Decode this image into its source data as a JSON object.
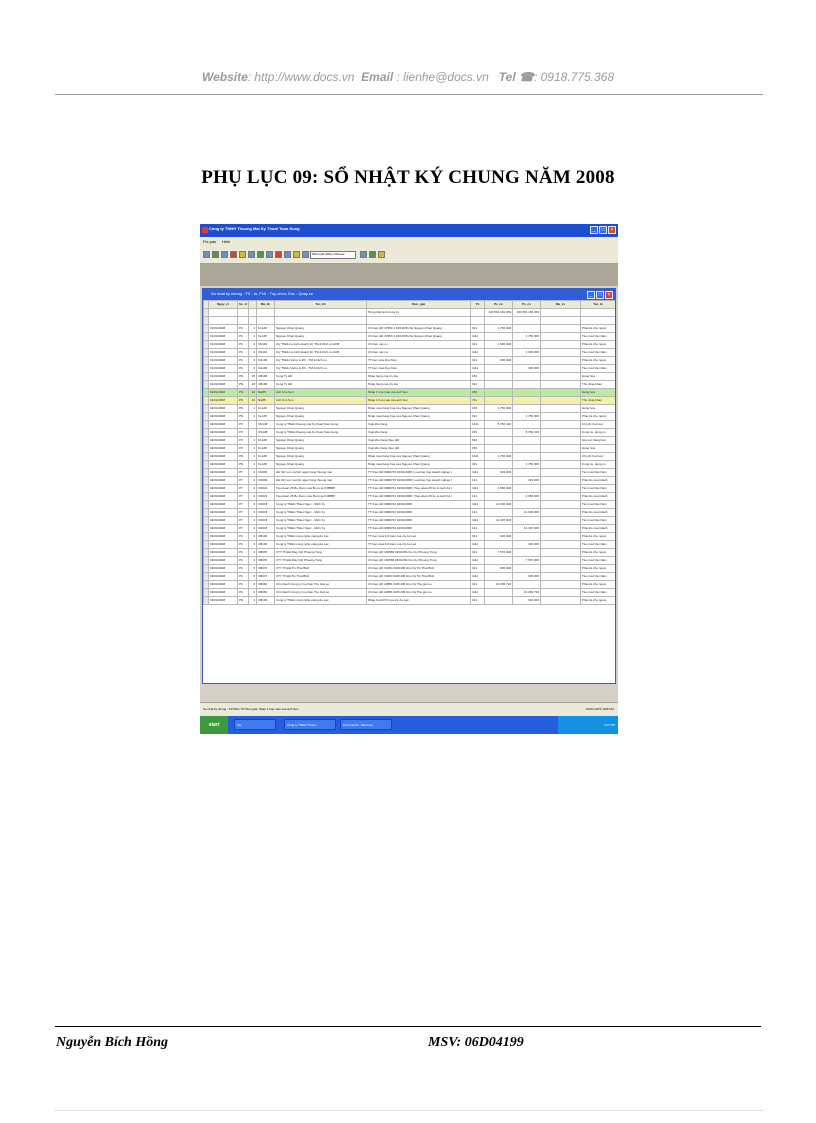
{
  "page_header": {
    "website_label": "Website",
    "website_value": ": http://www.docs.vn",
    "email_label": "Email",
    "email_value": ": lienhe@docs.vn",
    "tel_label": "Tel ☎",
    "tel_value": ": 0918.775.368"
  },
  "title": "PHỤ LỤC 09: SỔ NHẬT KÝ CHUNG NĂM 2008",
  "footer": {
    "author": "Nguyễn Bích Hồng",
    "msv": "MSV: 06D04199"
  },
  "screenshot": {
    "app_title": "Cong ty TNHH Thuong Mai Ky Thuat Toan Hung",
    "menu": [
      "Fix-pas",
      "Hele"
    ],
    "font_select": "Microsoft Office Chinese",
    "child_title": "So nhat ky chung - F3 - In, F10 - Tuy chon, Esc - Quay ra",
    "columns": [
      "Ngay_ct",
      "So_ct",
      "Ma_kh",
      "Ten_kh",
      "Dien_giai",
      "Tk",
      "Ps_no",
      "Ps_co",
      "Ma_vv",
      "Ten_tk"
    ],
    "opening_row": {
      "dien_giai": "Tong phat sinh trong ky",
      "ps_no": "130 563 184 369",
      "ps_co": "130 563 184 369"
    },
    "rows": [
      {
        "date": "01/01/2008",
        "type": "PC",
        "no": "1",
        "code": "KL128",
        "name": "Nguyen Khac Quang",
        "desc": "Chi tien HD 47950 1 18/12/08 cho Nguyen Khac Quang",
        "acct": "331",
        "debit": "1 750 000",
        "credit": "",
        "acct_name": "Phai tra cho nguoi"
      },
      {
        "date": "01/01/2008",
        "type": "PC",
        "no": "1",
        "code": "KL128",
        "name": "Nguyen Khac Quang",
        "desc": "Chi tien HD 47950 1 18/12/08 cho Nguyen Khac Quang",
        "acct": "1111",
        "debit": "",
        "credit": "1 750 000",
        "acct_name": "Tien mat Viet Nam"
      },
      {
        "date": "01/01/2008",
        "type": "PC",
        "no": "2",
        "code": "CN116",
        "name": "Cty TNHH sx kinh doanh Dl, TM & Dich vu ACB",
        "desc": "Chi tien vay cu",
        "acct": "331",
        "debit": "1 630 000",
        "credit": "",
        "acct_name": "Phai tra cho nguoi"
      },
      {
        "date": "01/01/2008",
        "type": "PC",
        "no": "2",
        "code": "CN116",
        "name": "Cty TNHH sx kinh doanh Dl, TM & Dich vu ACB",
        "desc": "Chi tien vay cu",
        "acct": "1111",
        "debit": "",
        "credit": "1 630 000",
        "acct_name": "Tien mat Viet Nam"
      },
      {
        "date": "01/01/2008",
        "type": "PC",
        "no": "3",
        "code": "KH139",
        "name": "Cty TNHH Vat tu & DV - TM & Dich vu",
        "desc": "TT tien mua thuc hien",
        "acct": "331",
        "debit": "300 000",
        "credit": "",
        "acct_name": "Phai tra cho nguoi"
      },
      {
        "date": "01/01/2008",
        "type": "PC",
        "no": "3",
        "code": "KH139",
        "name": "Cty TNHH Vat tu & DV - TM & Dich vu",
        "desc": "TT tien mua thuc hien",
        "acct": "1111",
        "debit": "",
        "credit": "300 000",
        "acct_name": "Tien mat Viet Nam"
      },
      {
        "date": "01/01/2008",
        "type": "PN",
        "no": "15",
        "code": "CB106",
        "name": "Cong Ty HD",
        "desc": "Nhap hang cua cty Ha",
        "acct": "156",
        "debit": "",
        "credit": "",
        "acct_name": "Hang hoa"
      },
      {
        "date": "01/01/2008",
        "type": "PN",
        "no": "15",
        "code": "CB106",
        "name": "Cong Ty HD",
        "desc": "Nhap hang cua cty Ha",
        "acct": "331",
        "debit": "",
        "credit": "",
        "acct_name": "Thu nhap khac"
      },
      {
        "date": "01/01/2008",
        "type": "PN",
        "no": "16",
        "code": "NH85",
        "name": "Anh Kim Son",
        "desc": "Nhap 1 hop mau cua anh Son",
        "acct": "156",
        "debit": "",
        "credit": "",
        "acct_name": "Hang hoa"
      },
      {
        "date": "01/01/2008",
        "type": "PN",
        "no": "16",
        "code": "NH85",
        "name": "Anh Kim Son",
        "desc": "Nhap 1 hop mau cua anh Son",
        "acct": "711",
        "debit": "",
        "credit": "",
        "acct_name": "Thu nhap khac"
      },
      {
        "date": "02/01/2008",
        "type": "PN",
        "no": "1",
        "code": "KL128",
        "name": "Nguyen Khac Quang",
        "desc": "Nhap mua hang hoa cua Nguyen Khac Quang",
        "acct": "156",
        "debit": "1 750 000",
        "credit": "",
        "acct_name": "Hang hoa"
      },
      {
        "date": "02/01/2008",
        "type": "PN",
        "no": "1",
        "code": "KL128",
        "name": "Nguyen Khac Quang",
        "desc": "Nhap mua hang hoa cua Nguyen Khac Quang",
        "acct": "331",
        "debit": "",
        "credit": "1 750 000",
        "acct_name": "Phai tra cho nguoi"
      },
      {
        "date": "02/01/2008",
        "type": "PX",
        "no": "",
        "code": "CN148",
        "name": "Cong ty TNHH thuong mai Ky thuat Toan Hung",
        "desc": "Xuat kho hang",
        "acct": "1421",
        "debit": "8 766 416",
        "credit": "",
        "acct_name": "Chi phi tra truoc"
      },
      {
        "date": "02/01/2008",
        "type": "PX",
        "no": "",
        "code": "CN148",
        "name": "Cong ty TNHH thuong mai Ky thuat Toan Hung",
        "desc": "Xuat kho hang",
        "acct": "153",
        "debit": "",
        "credit": "8 766 416",
        "acct_name": "Cong cu, dung cu"
      },
      {
        "date": "02/01/2008",
        "type": "PX",
        "no": "1",
        "code": "KL128",
        "name": "Nguyen Khac Quang",
        "desc": "Xuat kho hang theo HD",
        "acct": "632",
        "debit": "",
        "credit": "",
        "acct_name": "Gia von hang ban"
      },
      {
        "date": "02/01/2008",
        "type": "PX",
        "no": "1",
        "code": "KL128",
        "name": "Nguyen Khac Quang",
        "desc": "Xuat kho hang theo HD",
        "acct": "156",
        "debit": "",
        "credit": "",
        "acct_name": "Hang hoa"
      },
      {
        "date": "02/01/2008",
        "type": "PN",
        "no": "1",
        "code": "KL128",
        "name": "Nguyen Khac Quang",
        "desc": "Nhap mua hang hoa cua Nguyen Khac Quang",
        "acct": "1421",
        "debit": "1 750 000",
        "credit": "",
        "acct_name": "Chi phi tra truoc"
      },
      {
        "date": "02/01/2008",
        "type": "PN",
        "no": "1",
        "code": "KL128",
        "name": "Nguyen Khac Quang",
        "desc": "Nhap mua hang hoa cua Nguyen Khac Quang",
        "acct": "331",
        "debit": "",
        "credit": "1 750 000",
        "acct_name": "Cong cu, dung cu"
      },
      {
        "date": "02/01/2008",
        "type": "PT",
        "no": "2",
        "code": "CN004",
        "name": "HH Ghi von va tinh ngan hang thuong mai",
        "desc": "TT theo HD 0099715 02/01/2008 ( Lua hop hop doanh nghiep )",
        "acct": "1111",
        "debit": "323 000",
        "credit": "",
        "acct_name": "Tien mat Viet Nam"
      },
      {
        "date": "02/01/2008",
        "type": "PT",
        "no": "2",
        "code": "CN004",
        "name": "HH Ghi von va tinh ngan hang thuong mai",
        "desc": "TT theo HD 0099715 02/01/2008 ( Lua hop hop doanh nghiep )",
        "acct": "131",
        "debit": "",
        "credit": "323 000",
        "acct_name": "Phai thu cua khach"
      },
      {
        "date": "02/01/2008",
        "type": "PT",
        "no": "2",
        "code": "CN023",
        "name": "Tieu doan 25 Bo tham muu Bo tu lenh BBBP",
        "desc": "TT theo HD 0099721 02/01/2008 ( Tieu doan 25 bo tu lenh bd )",
        "acct": "1111",
        "debit": "2 950 000",
        "credit": "",
        "acct_name": "Tien mat Viet Nam"
      },
      {
        "date": "02/01/2008",
        "type": "PT",
        "no": "2",
        "code": "CN023",
        "name": "Tieu doan 25 Bo tham muu Bo tu lenh BBBP",
        "desc": "TT theo HD 0099721 02/01/2008 ( Tieu doan 25 bo tu lenh bd )",
        "acct": "131",
        "debit": "",
        "credit": "2 950 000",
        "acct_name": "Phai thu cua khach"
      },
      {
        "date": "02/01/2008",
        "type": "PT",
        "no": "3",
        "code": "CN018",
        "name": "Cong ty TNHH Thien Ngoc - Minh Ky",
        "desc": "TT theo HD 0099722 02/01/2008",
        "acct": "1111",
        "debit": "12 940 000",
        "credit": "",
        "acct_name": "Tien mat Viet Nam"
      },
      {
        "date": "02/01/2008",
        "type": "PT",
        "no": "3",
        "code": "CN018",
        "name": "Cong ty TNHH Thien Ngoc - Minh Ky",
        "desc": "TT theo HD 0099722 02/01/2008",
        "acct": "131",
        "debit": "",
        "credit": "12 940 000",
        "acct_name": "Phai thu cua khach"
      },
      {
        "date": "02/01/2008",
        "type": "PT",
        "no": "4",
        "code": "CN018",
        "name": "Cong ty TNHH Thien Ngoc - Minh Ky",
        "desc": "TT theo HD 0099723 02/01/2008",
        "acct": "1111",
        "debit": "14 497 000",
        "credit": "",
        "acct_name": "Tien mat Viet Nam"
      },
      {
        "date": "02/01/2008",
        "type": "PT",
        "no": "4",
        "code": "CN018",
        "name": "Cong ty TNHH Thien Ngoc - Minh Ky",
        "desc": "TT theo HD 0099723 02/01/2008",
        "acct": "131",
        "debit": "",
        "credit": "14 497 000",
        "acct_name": "Phai thu cua khach"
      },
      {
        "date": "03/01/2008",
        "type": "PC",
        "no": "3",
        "code": "CB104",
        "name": "Cong ty TNHH cong nghe mang Au Lac",
        "desc": "TT tien mua linh kien cua cty Au Lac",
        "acct": "331",
        "debit": "320 000",
        "credit": "",
        "acct_name": "Phai tra cho nguoi"
      },
      {
        "date": "03/01/2008",
        "type": "PC",
        "no": "3",
        "code": "CB104",
        "name": "Cong ty TNHH cong nghe mang Au Lac",
        "desc": "TT tien mua linh kien cua cty Au Lac",
        "acct": "1111",
        "debit": "",
        "credit": "320 000",
        "acct_name": "Tien mat Viet Nam"
      },
      {
        "date": "03/01/2008",
        "type": "PC",
        "no": "4",
        "code": "CB070",
        "name": "CTY TNHH May tinh Phuong Tung",
        "desc": "Chi tien HD 160583 03/01/08 cho Cty Phuong Tung",
        "acct": "331",
        "debit": "7 570 000",
        "credit": "",
        "acct_name": "Phai tra cho nguoi"
      },
      {
        "date": "03/01/2008",
        "type": "PC",
        "no": "4",
        "code": "CB070",
        "name": "CTY TNHH May tinh Phuong Tung",
        "desc": "Chi tien HD 160583 03/01/08 cho Cty Phuong Tung",
        "acct": "1111",
        "debit": "",
        "credit": "7 570 000",
        "acct_name": "Tien mat Viet Nam"
      },
      {
        "date": "03/01/2008",
        "type": "PC",
        "no": "5",
        "code": "CB072",
        "name": "CTY TNHH Tin Thai Binh",
        "desc": "Chi tien HD 34354 03/01/08 cho Cty Tin Thai Binh",
        "acct": "331",
        "debit": "605 000",
        "credit": "",
        "acct_name": "Phai tra cho nguoi"
      },
      {
        "date": "03/01/2008",
        "type": "PC",
        "no": "5",
        "code": "CB072",
        "name": "CTY TNHH Tin Thai Binh",
        "desc": "Chi tien HD 34354 03/01/08 cho Cty Tin Thai Binh",
        "acct": "1111",
        "debit": "",
        "credit": "605 000",
        "acct_name": "Tien mat Viet Nam"
      },
      {
        "date": "03/01/2008",
        "type": "PC",
        "no": "6",
        "code": "CB081",
        "name": "Chi nhanh Cong ty Co phan The Gioi so",
        "desc": "Chi tien HD 22881 03/01/08 cho Cty The gioi so",
        "acct": "331",
        "debit": "10 282 732",
        "credit": "",
        "acct_name": "Phai tra cho nguoi"
      },
      {
        "date": "03/01/2008",
        "type": "PC",
        "no": "6",
        "code": "CB081",
        "name": "Chi nhanh Cong ty Co phan The Gioi so",
        "desc": "Chi tien HD 22881 03/01/08 cho Cty The gioi so",
        "acct": "1111",
        "debit": "",
        "credit": "10 282 732",
        "acct_name": "Tien mat Viet Nam"
      },
      {
        "date": "03/01/2008",
        "type": "PN",
        "no": "1",
        "code": "CB104",
        "name": "Cong ty TNHH cong nghe mang Au Lac",
        "desc": "Nhap Card PCI cua cty Au Lac",
        "acct": "331",
        "debit": "",
        "credit": "320 000",
        "acct_name": "Phai tra cho nguoi"
      }
    ],
    "status_text": "So nhat ky chung : 137400 / 97 Dien giai: Nhap 1 hop mau cua anh Son",
    "status_keys": "NUM CAPS 10/07/12",
    "taskbar": {
      "start": "start",
      "items": [
        "NH",
        "Cong ty TNHH Thuon...",
        "Document1 - Microsof..."
      ],
      "clock": "4:07 PM"
    }
  }
}
